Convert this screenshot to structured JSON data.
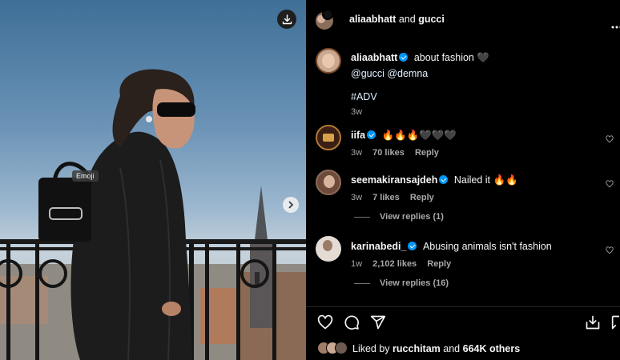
{
  "photo": {
    "tooltip": "Emoji",
    "download_icon": "download-icon",
    "next_icon": "chevron-right-icon"
  },
  "header": {
    "owner": "aliaabhatt",
    "and_word": "and",
    "collaborator": "gucci",
    "more_icon": "more-icon"
  },
  "caption": {
    "username": "aliaabhatt",
    "text": "about fashion 🖤",
    "mentions": "@gucci @demna",
    "hashtag": "#ADV",
    "time": "3w"
  },
  "comments": [
    {
      "username": "iifa",
      "verified": true,
      "text": "🔥🔥🔥🖤🖤🖤",
      "time": "3w",
      "likes": "70 likes",
      "reply": "Reply"
    },
    {
      "username": "seemakiransajdeh",
      "verified": true,
      "text": "Nailed it 🔥🔥",
      "time": "3w",
      "likes": "7 likes",
      "reply": "Reply",
      "view_replies": "View replies (1)"
    },
    {
      "username": "karinabedi_",
      "verified": true,
      "text": "Abusing animals isn't fashion",
      "time": "1w",
      "likes": "2,102 likes",
      "reply": "Reply",
      "view_replies": "View replies (16)"
    }
  ],
  "actions": {
    "like_icon": "heart-icon",
    "comment_icon": "comment-icon",
    "share_icon": "share-icon",
    "save_icon": "save-icon"
  },
  "likes": {
    "prefix": "Liked by",
    "user": "rucchitam",
    "middle": "and",
    "count": "664K others"
  },
  "colors": {
    "background": "#000000",
    "verified": "#0095f6",
    "link": "#e0f1ff",
    "muted": "#a8a8a8"
  }
}
